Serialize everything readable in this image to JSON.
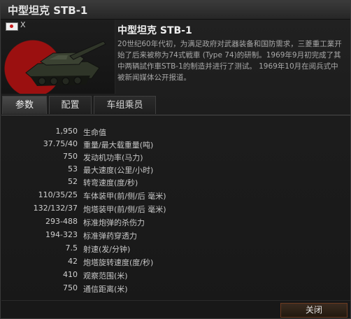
{
  "window": {
    "title": "中型坦克 STB-1"
  },
  "vehicle": {
    "nation_flag": "japan-flag",
    "tier": "X",
    "name": "中型坦克 STB-1",
    "description": "20世纪60年代初，为满足政府对武器装备和国防需求，三菱重工業开始了后来被称为74式戦車 (Type 74)的研制。1969年9月初完成了其中两辆試作車STB-1的制造并进行了测试。 1969年10月在阅兵式中被新闻媒体公开报道。"
  },
  "tabs": [
    {
      "label": "参数",
      "active": true
    },
    {
      "label": "配置",
      "active": false
    },
    {
      "label": "车组乘员",
      "active": false
    }
  ],
  "stats": [
    {
      "value": "1,950",
      "label": "生命值"
    },
    {
      "value": "37.75/40",
      "label": "重量/最大载重量(吨)"
    },
    {
      "value": "750",
      "label": "发动机功率(马力)"
    },
    {
      "value": "53",
      "label": "最大速度(公里/小时)"
    },
    {
      "value": "52",
      "label": "转弯速度(度/秒)"
    },
    {
      "value": "110/35/25",
      "label": "车体装甲(前/侧/后 毫米)"
    },
    {
      "value": "132/132/37",
      "label": "炮塔装甲(前/侧/后 毫米)"
    },
    {
      "value": "293-488",
      "label": "标准炮弹的杀伤力"
    },
    {
      "value": "194-323",
      "label": "标准弹药穿透力"
    },
    {
      "value": "7.5",
      "label": "射速(发/分钟)"
    },
    {
      "value": "42",
      "label": "炮塔旋转速度(度/秒)"
    },
    {
      "value": "410",
      "label": "观察范围(米)"
    },
    {
      "value": "750",
      "label": "通信距离(米)"
    }
  ],
  "footer": {
    "close_label": "关闭"
  },
  "colors": {
    "accent_red": "#9b1010",
    "button_border": "#6b3a20"
  }
}
